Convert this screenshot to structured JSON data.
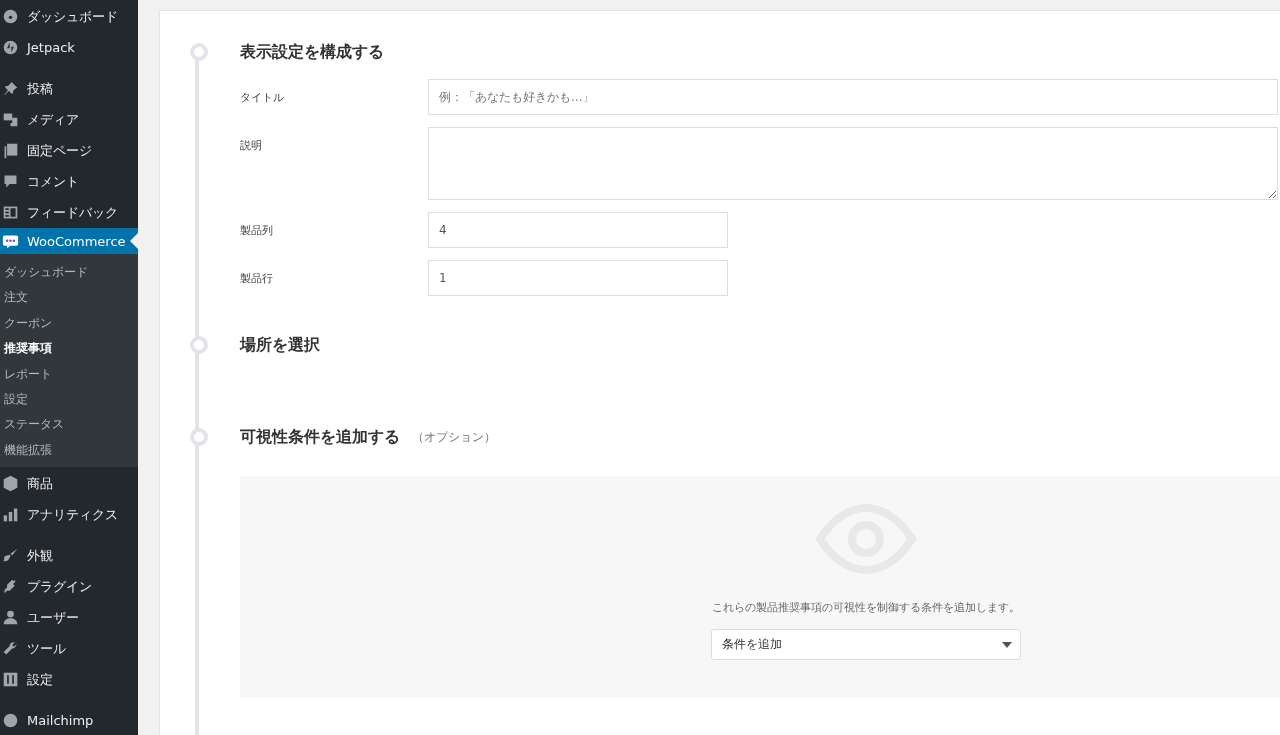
{
  "sidebar": {
    "groups": [
      {
        "items": [
          {
            "label": "ダッシュボード",
            "selected": false
          },
          {
            "label": "Jetpack",
            "selected": false
          }
        ]
      },
      {
        "items": [
          {
            "label": "投稿",
            "selected": false
          },
          {
            "label": "メディア",
            "selected": false
          },
          {
            "label": "固定ページ",
            "selected": false
          },
          {
            "label": "コメント",
            "selected": false
          },
          {
            "label": "フィードバック",
            "selected": false
          },
          {
            "label": "WooCommerce",
            "selected": true,
            "submenu": [
              {
                "label": "ダッシュボード",
                "selected": false
              },
              {
                "label": "注文",
                "selected": false
              },
              {
                "label": "クーポン",
                "selected": false
              },
              {
                "label": "推奨事項",
                "selected": true
              },
              {
                "label": "レポート",
                "selected": false
              },
              {
                "label": "設定",
                "selected": false
              },
              {
                "label": "ステータス",
                "selected": false
              },
              {
                "label": "機能拡張",
                "selected": false
              }
            ]
          },
          {
            "label": "商品",
            "selected": false
          },
          {
            "label": "アナリティクス",
            "selected": false
          }
        ]
      },
      {
        "items": [
          {
            "label": "外観",
            "selected": false
          },
          {
            "label": "プラグイン",
            "selected": false
          },
          {
            "label": "ユーザー",
            "selected": false
          },
          {
            "label": "ツール",
            "selected": false
          },
          {
            "label": "設定",
            "selected": false
          }
        ]
      },
      {
        "items": [
          {
            "label": "Mailchimp",
            "selected": false
          }
        ]
      }
    ]
  },
  "steps": [
    {
      "kind": "fields",
      "title": "表示設定を構成する",
      "fields": [
        {
          "kind": "text",
          "label": "タイトル",
          "placeholder": "例：「あなたも好きかも...」"
        },
        {
          "kind": "textarea",
          "label": "説明"
        },
        {
          "kind": "number",
          "label": "製品列",
          "value": "4"
        },
        {
          "kind": "number",
          "label": "製品行",
          "value": "1"
        }
      ]
    },
    {
      "kind": "empty",
      "title": "場所を選択"
    },
    {
      "kind": "conditions",
      "title": "可視性条件を追加する",
      "note": "（オプション）",
      "description": "これらの製品推奨事項の可視性を制御する条件を追加します。",
      "select": "条件を追加"
    }
  ]
}
